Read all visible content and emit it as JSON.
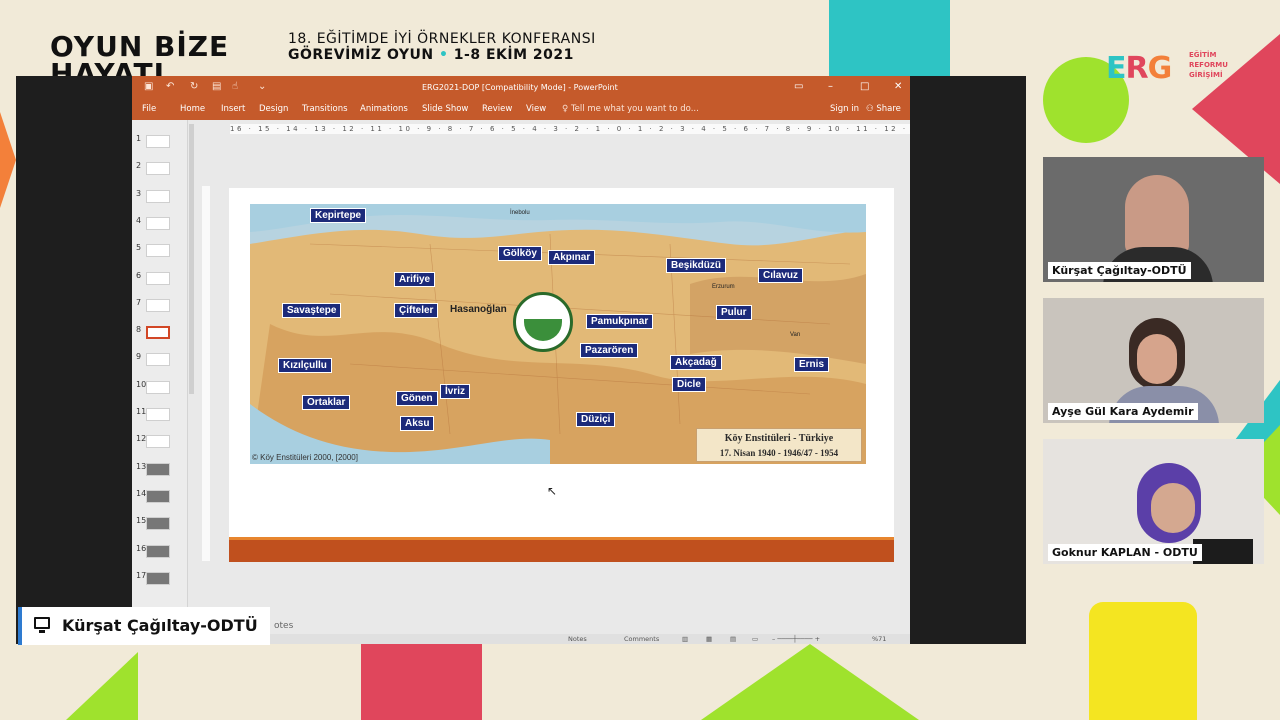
{
  "event": {
    "brand_line1": "OYUN BİZE",
    "brand_line2": "HAYATI",
    "conference_title": "18. EĞİTİMDE İYİ ÖRNEKLER KONFERANSI",
    "conference_theme": "GÖREVİMİZ OYUN",
    "conference_dates": "1-8 EKİM 2021",
    "org_logo": "ERG",
    "org_name_lines": [
      "EĞİTİM",
      "REFORMU",
      "GİRİŞİMİ"
    ]
  },
  "powerpoint": {
    "window_title": "ERG2021-DOP [Compatibility Mode] - PowerPoint",
    "tabs": [
      "File",
      "Home",
      "Insert",
      "Design",
      "Transitions",
      "Animations",
      "Slide Show",
      "Review",
      "View"
    ],
    "tell_me": "Tell me what you want to do...",
    "sign_in": "Sign in",
    "share": "Share",
    "ruler_text": "16 · 15 · 14 · 13 · 12 · 11 · 10 · 9 · 8 · 7 · 6 · 5 · 4 · 3 · 2 · 1 · 0 · 1 · 2 · 3 · 4 · 5 · 6 · 7 · 8 · 9 · 10 · 11 · 12 · 13 · 14 · 15 · 16",
    "slide_numbers": [
      "1",
      "2",
      "3",
      "4",
      "5",
      "6",
      "7",
      "8",
      "9",
      "10",
      "11",
      "12",
      "13",
      "14",
      "15",
      "16",
      "17"
    ],
    "selected_slide": "8",
    "notes_label": "otes",
    "status": {
      "notes": "Notes",
      "comments": "Comments",
      "zoom": "%71"
    }
  },
  "slide": {
    "institutes": [
      "Kepirtepe",
      "Gölköy",
      "Akpınar",
      "Beşikdüzü",
      "Cılavuz",
      "Arifiye",
      "Savaştepe",
      "Çifteler",
      "Pamukpınar",
      "Pulur",
      "Pazarören",
      "Kızılçullu",
      "Akçadağ",
      "Ernis",
      "Ortaklar",
      "Gönen",
      "İvriz",
      "Dicle",
      "Aksu",
      "Düziçi"
    ],
    "place_hasanoglan": "Hasanoğlan",
    "source": "© Köy Enstitüleri 2000, [2000]",
    "legend_title": "Köy Enstitüleri - Türkiye",
    "legend_dates": "17. Nisan 1940 - 1946/47 - 1954"
  },
  "presenter": {
    "name": "Kürşat Çağıltay-ODTÜ"
  },
  "participants": [
    {
      "name": "Kürşat Çağıltay-ODTÜ"
    },
    {
      "name": "Ayşe Gül Kara Aydemir"
    },
    {
      "name": "Goknur KAPLAN - ODTU"
    }
  ],
  "colors": {
    "ppt_accent": "#c55a2b",
    "teal": "#2ec4c4",
    "lime": "#9fe22d",
    "pink": "#e0465c",
    "yellow": "#f4e521"
  }
}
